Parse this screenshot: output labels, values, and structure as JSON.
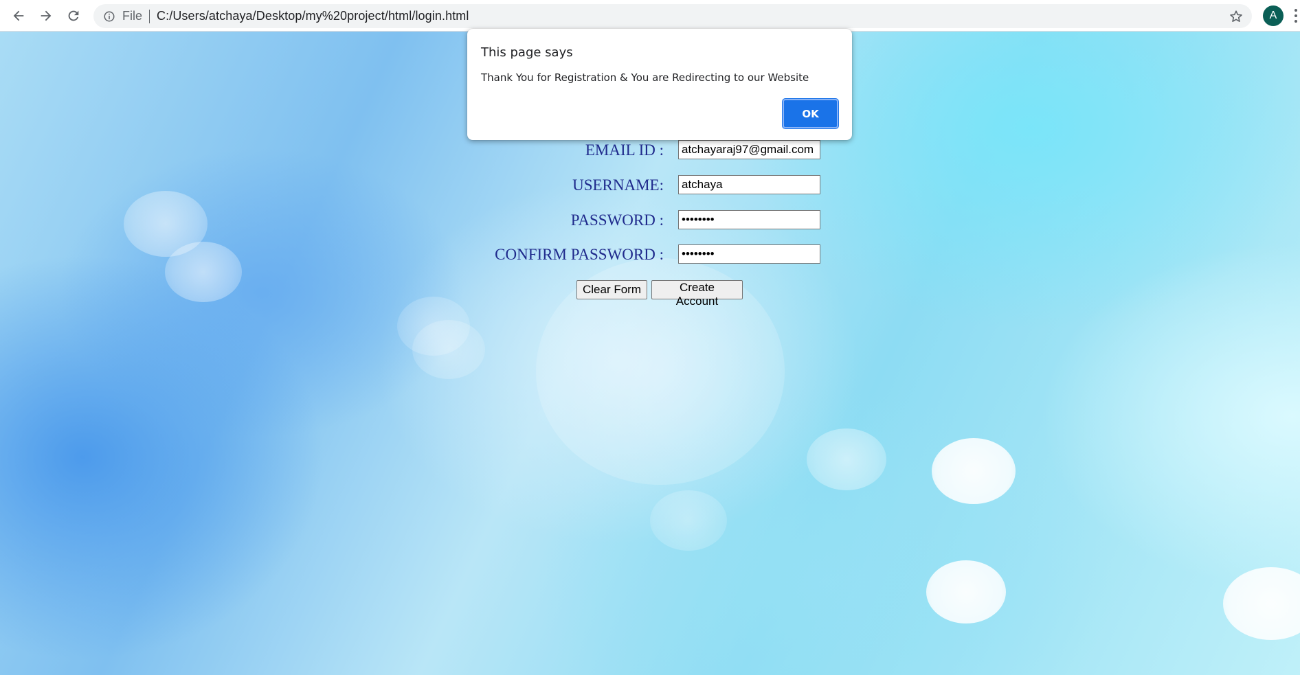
{
  "browser": {
    "back_icon": "arrow-left-icon",
    "forward_icon": "arrow-right-icon",
    "reload_icon": "reload-icon",
    "info_icon": "info-icon",
    "scheme_label": "File",
    "url": "C:/Users/atchaya/Desktop/my%20project/html/login.html",
    "star_icon": "star-icon",
    "profile_initial": "A",
    "profile_color": "#0b5f56"
  },
  "form": {
    "email": {
      "label": "EMAIL ID :",
      "value": "atchayaraj97@gmail.com"
    },
    "username": {
      "label": "USERNAME:",
      "value": "atchaya"
    },
    "password": {
      "label": "PASSWORD :",
      "value": "atchaya1"
    },
    "confirm_password": {
      "label": "CONFIRM PASSWORD :",
      "value": "atchaya1"
    },
    "clear_label": "Clear Form",
    "create_label": "Create Account"
  },
  "alert": {
    "title": "This page says",
    "message": "Thank You for Registration & You are Redirecting to our Website",
    "ok_label": "OK",
    "accent_color": "#1a73e8"
  },
  "colors": {
    "label_text": "#1f2a8c"
  }
}
